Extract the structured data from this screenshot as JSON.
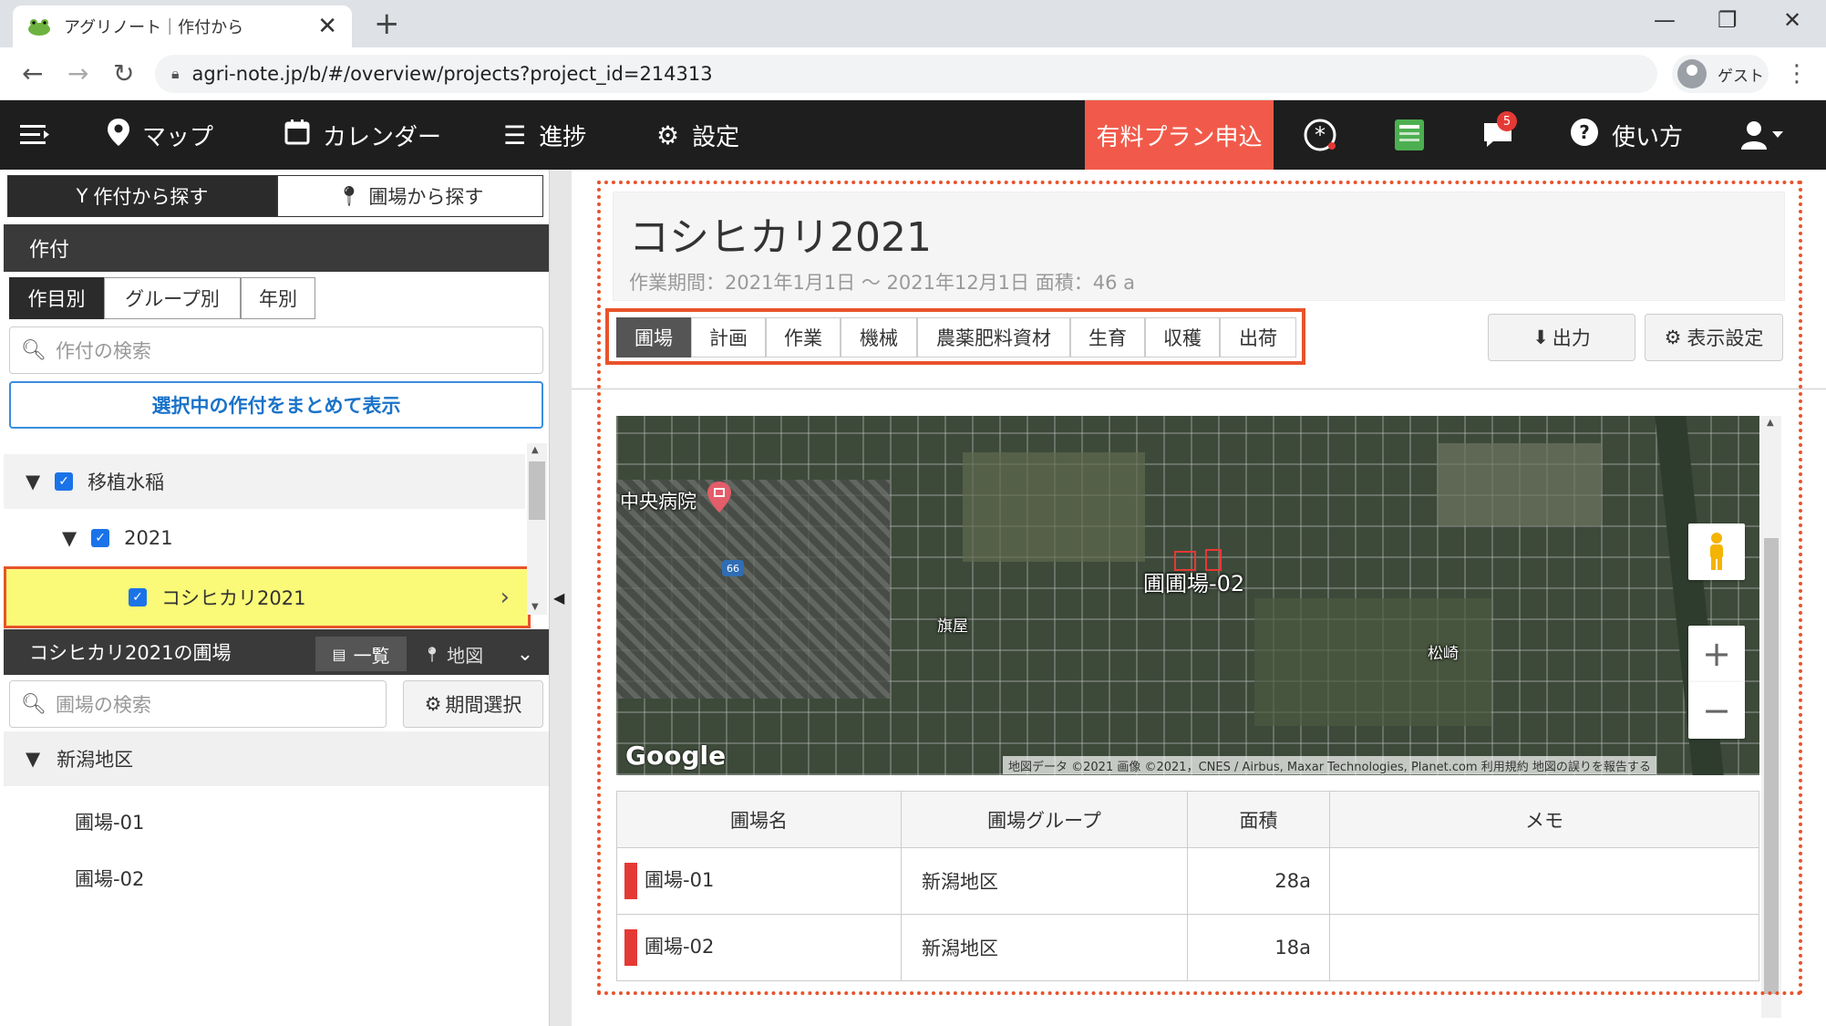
{
  "browser": {
    "tab_title": "アグリノート｜作付から",
    "url": "agri-note.jp/b/#/overview/projects?project_id=214313",
    "profile": "ゲスト"
  },
  "nav": {
    "map": "マップ",
    "calendar": "カレンダー",
    "progress": "進捗",
    "settings": "設定",
    "plan": "有料プラン申込",
    "notif_count": "5",
    "help": "使い方"
  },
  "left": {
    "search_by_crop": "作付から探す",
    "search_by_field": "圃場から探す",
    "crop_header": "作付",
    "subtabs": [
      "作目別",
      "グループ別",
      "年別"
    ],
    "crop_search_placeholder": "作付の検索",
    "show_selected": "選択中の作付をまとめて表示",
    "tree": {
      "root": "移植水稲",
      "year": "2021",
      "crop": "コシヒカリ2021"
    },
    "fields_header": "コシヒカリ2021の圃場",
    "list_btn": "一覧",
    "map_btn": "地図",
    "field_search_placeholder": "圃場の検索",
    "period_btn": "期間選択",
    "area": "新潟地区",
    "fields": [
      "圃場-01",
      "圃場-02"
    ]
  },
  "main": {
    "title": "コシヒカリ2021",
    "meta": "作業期間：2021年1月1日 ～ 2021年12月1日  面積：46 a",
    "tabs": [
      "圃場",
      "計画",
      "作業",
      "機械",
      "農薬肥料資材",
      "生育",
      "収穫",
      "出荷"
    ],
    "export": "出力",
    "display_settings": "表示設定",
    "map": {
      "hospital": "中央病院",
      "route": "66",
      "place1": "旗屋",
      "place2": "松崎",
      "field_label": "圃圃場-02",
      "google": "Google",
      "attribution": "地図データ ©2021 画像 ©2021，CNES / Airbus, Maxar Technologies, Planet.com   利用規約   地図の誤りを報告する"
    },
    "table": {
      "headers": [
        "圃場名",
        "圃場グループ",
        "面積",
        "メモ"
      ],
      "rows": [
        {
          "name": "圃場-01",
          "group": "新潟地区",
          "area": "28a",
          "memo": ""
        },
        {
          "name": "圃場-02",
          "group": "新潟地区",
          "area": "18a",
          "memo": ""
        }
      ]
    }
  }
}
